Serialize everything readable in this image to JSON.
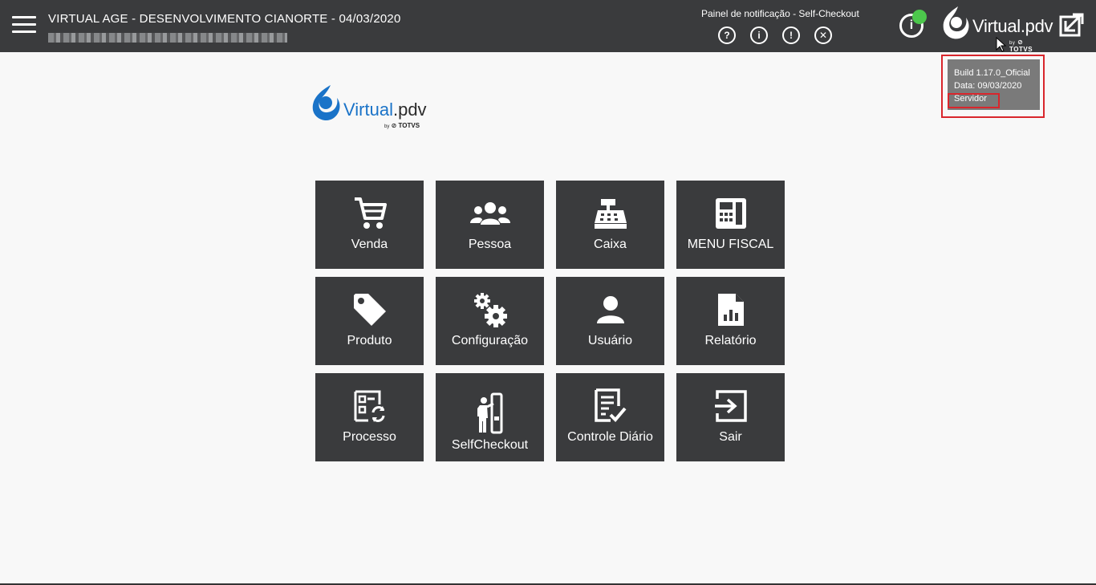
{
  "header": {
    "title": "VIRTUAL AGE - DESENVOLVIMENTO CIANORTE - 04/03/2020",
    "notification_panel_title": "Painel de notificação - Self-Checkout",
    "notification_icons": [
      {
        "name": "help-icon",
        "glyph": "?"
      },
      {
        "name": "info-icon",
        "glyph": "i"
      },
      {
        "name": "warning-icon",
        "glyph": "!"
      },
      {
        "name": "close-icon",
        "glyph": "✕"
      }
    ],
    "info_button_glyph": "i",
    "status_color": "#4cc74c"
  },
  "brand": {
    "name_main": "Virtual",
    "name_suffix": ".pdv",
    "by": "by",
    "partner": "TOTVS",
    "accent_color": "#1a73c8"
  },
  "tooltip": {
    "build": "Build 1.17.0_Oficial",
    "date": "Data: 09/03/2020",
    "server": "Servidor"
  },
  "menu": {
    "tiles": [
      {
        "label": "Venda",
        "icon": "cart-icon"
      },
      {
        "label": "Pessoa",
        "icon": "people-icon"
      },
      {
        "label": "Caixa",
        "icon": "cash-register-icon"
      },
      {
        "label": "MENU FISCAL",
        "icon": "calculator-icon"
      },
      {
        "label": "Produto",
        "icon": "tag-icon"
      },
      {
        "label": "Configuração",
        "icon": "gears-icon"
      },
      {
        "label": "Usuário",
        "icon": "user-icon"
      },
      {
        "label": "Relatório",
        "icon": "report-icon"
      },
      {
        "label": "Processo",
        "icon": "process-icon"
      },
      {
        "label": "SelfCheckout",
        "icon": "self-checkout-icon"
      },
      {
        "label": "Controle Diário",
        "icon": "daily-control-icon"
      },
      {
        "label": "Sair",
        "icon": "exit-icon"
      }
    ]
  }
}
